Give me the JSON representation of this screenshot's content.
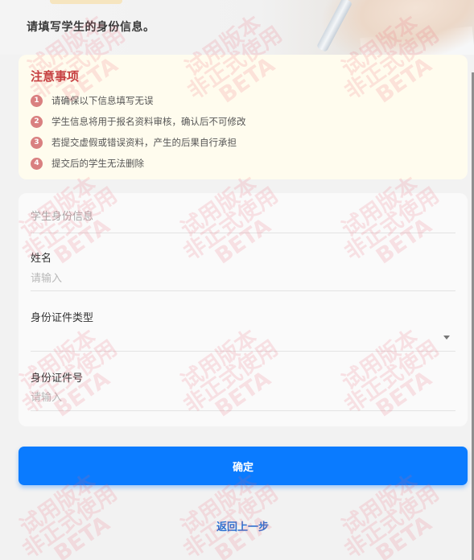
{
  "header": {
    "title": "请填写学生的身份信息。"
  },
  "notice": {
    "title": "注意事项",
    "items": [
      {
        "num": "1",
        "text": "请确保以下信息填写无误"
      },
      {
        "num": "2",
        "text": "学生信息将用于报名资料审核，确认后不可修改"
      },
      {
        "num": "3",
        "text": "若提交虚假或错误资料，产生的后果自行承担"
      },
      {
        "num": "4",
        "text": "提交后的学生无法删除"
      }
    ]
  },
  "form": {
    "section_title": "学生身份信息",
    "name": {
      "label": "姓名",
      "placeholder": "请输入",
      "value": ""
    },
    "id_type": {
      "label": "身份证件类型",
      "value": ""
    },
    "id_number": {
      "label": "身份证件号",
      "placeholder": "请输入",
      "value": ""
    }
  },
  "actions": {
    "confirm_label": "确定",
    "back_label": "返回上一步"
  },
  "watermark": {
    "line1": "试用版本",
    "line2": "非正式使用",
    "line3": "BETA"
  },
  "colors": {
    "primary": "#0a7bff",
    "notice_title": "#c43f3f",
    "notice_bg": "#fffcee",
    "badge": "#d98080",
    "link": "#2a6fd1"
  }
}
